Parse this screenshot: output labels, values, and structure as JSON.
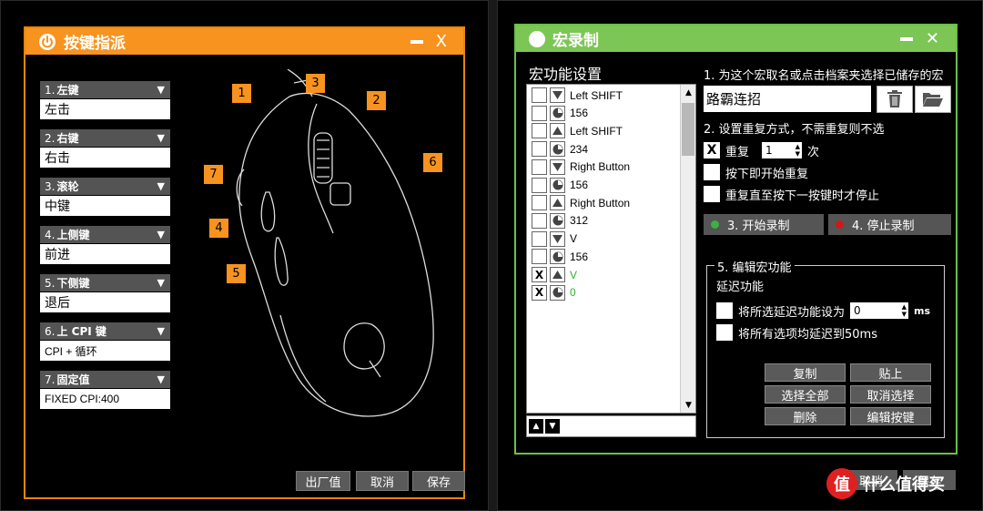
{
  "key_dialog": {
    "title": "按键指派",
    "keys": [
      {
        "num": "1.",
        "name": "左键",
        "value": "左击"
      },
      {
        "num": "2.",
        "name": "右键",
        "value": "右击"
      },
      {
        "num": "3.",
        "name": "滚轮",
        "value": "中键"
      },
      {
        "num": "4.",
        "name": "上侧键",
        "value": "前进"
      },
      {
        "num": "5.",
        "name": "下侧键",
        "value": "退后"
      },
      {
        "num": "6.",
        "name": "上 CPI 键",
        "value": "CPI + 循环"
      },
      {
        "num": "7.",
        "name": "固定值",
        "value": "FIXED CPI:400"
      }
    ],
    "callouts": [
      "1",
      "2",
      "3",
      "4",
      "5",
      "6",
      "7"
    ],
    "buttons": {
      "factory": "出厂值",
      "cancel": "取消",
      "save": "保存"
    }
  },
  "macro_dialog": {
    "title": "宏录制",
    "list_title": "宏功能设置",
    "items": [
      {
        "checked": "",
        "type": "down",
        "label": "Left SHIFT",
        "green": false
      },
      {
        "checked": "",
        "type": "delay",
        "label": "156",
        "green": false
      },
      {
        "checked": "",
        "type": "up",
        "label": "Left SHIFT",
        "green": false
      },
      {
        "checked": "",
        "type": "delay",
        "label": "234",
        "green": false
      },
      {
        "checked": "",
        "type": "down",
        "label": "Right Button",
        "green": false
      },
      {
        "checked": "",
        "type": "delay",
        "label": "156",
        "green": false
      },
      {
        "checked": "",
        "type": "up",
        "label": "Right Button",
        "green": false
      },
      {
        "checked": "",
        "type": "delay",
        "label": "312",
        "green": false
      },
      {
        "checked": "",
        "type": "down",
        "label": "V",
        "green": false
      },
      {
        "checked": "",
        "type": "delay",
        "label": "156",
        "green": false
      },
      {
        "checked": "X",
        "type": "up",
        "label": "V",
        "green": true
      },
      {
        "checked": "X",
        "type": "delay",
        "label": "0",
        "green": true
      }
    ],
    "step1": "1. 为这个宏取名或点击档案夹选择已储存的宏",
    "macro_name": "路霸连招",
    "step2": "2. 设置重复方式，不需重复则不选",
    "repeat_check": "X",
    "repeat_label": "重复",
    "repeat_count": "1",
    "repeat_unit": "次",
    "opt_press_start": "按下即开始重复",
    "opt_until_next": "重复直至按下一按键时才停止",
    "start_record": "3. 开始录制",
    "stop_record": "4. 停止录制",
    "start_dot_color": "#3cb043",
    "stop_dot_color": "#d01818",
    "edit_title": "5. 编辑宏功能",
    "delay_title": "延迟功能",
    "set_delay_label": "将所选延迟功能设为",
    "delay_value": "0",
    "delay_unit": "ms",
    "all_delay_label": "将所有选项均延迟到50ms",
    "btn_copy": "复制",
    "btn_paste": "贴上",
    "btn_select_all": "选择全部",
    "btn_deselect": "取消选择",
    "btn_delete": "删除",
    "btn_edit_key": "编辑按键"
  },
  "background_buttons": {
    "cancel": "取消",
    "save": "保存"
  },
  "watermark": {
    "logo": "值",
    "text": "什么值得买"
  },
  "colors": {
    "orange": "#f7931e",
    "green": "#7cc655"
  }
}
